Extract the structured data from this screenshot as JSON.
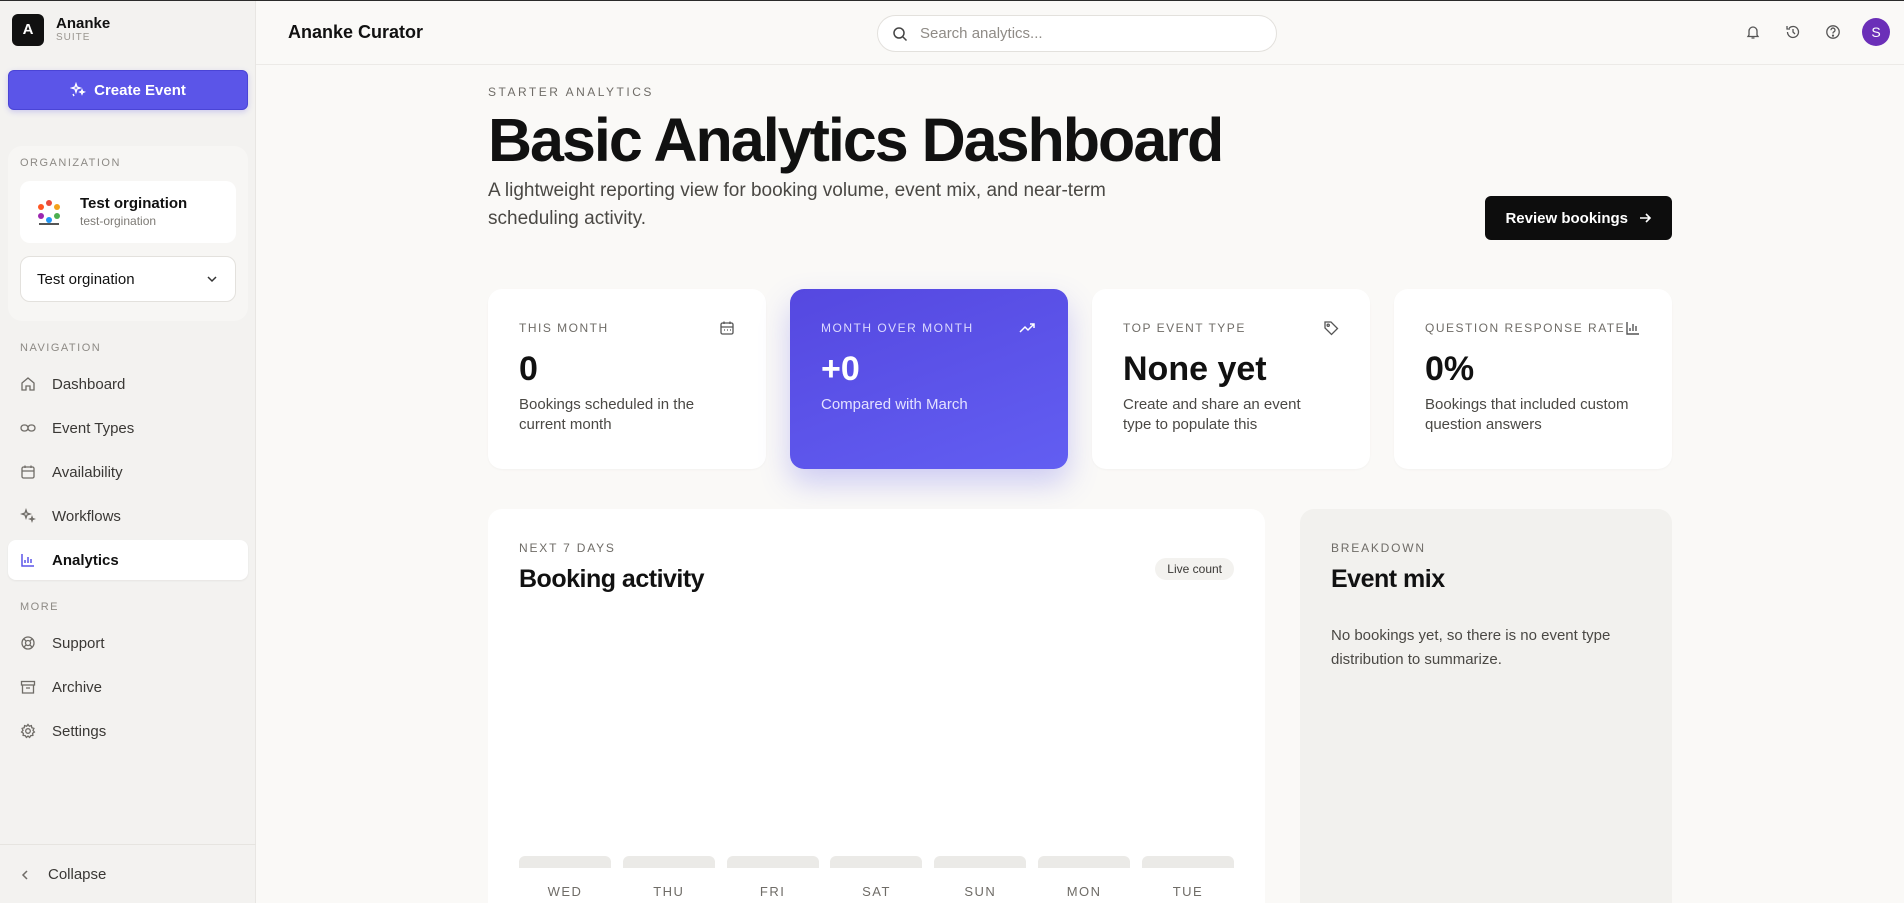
{
  "brand": {
    "initial": "A",
    "name": "Ananke",
    "sub": "SUITE"
  },
  "sidebar": {
    "create_label": "Create Event",
    "org_section_label": "ORGANIZATION",
    "org_name": "Test orgination",
    "org_slug": "test-orgination",
    "org_select_value": "Test orgination",
    "nav_label": "NAVIGATION",
    "nav_items": [
      {
        "label": "Dashboard",
        "icon": "home-icon"
      },
      {
        "label": "Event Types",
        "icon": "link-icon"
      },
      {
        "label": "Availability",
        "icon": "calendar-icon"
      },
      {
        "label": "Workflows",
        "icon": "sparkle-icon"
      },
      {
        "label": "Analytics",
        "icon": "bar-chart-icon",
        "active": true
      }
    ],
    "more_label": "MORE",
    "more_items": [
      {
        "label": "Support",
        "icon": "lifebuoy-icon"
      },
      {
        "label": "Archive",
        "icon": "archive-icon"
      },
      {
        "label": "Settings",
        "icon": "gear-icon"
      }
    ],
    "collapse_label": "Collapse"
  },
  "topbar": {
    "title": "Ananke Curator",
    "search_placeholder": "Search analytics...",
    "avatar_initial": "S"
  },
  "page": {
    "eyebrow": "STARTER ANALYTICS",
    "title": "Basic Analytics Dashboard",
    "description": "A lightweight reporting view for booking volume, event mix, and near-term scheduling activity.",
    "review_label": "Review bookings"
  },
  "stats": [
    {
      "label": "THIS MONTH",
      "value": "0",
      "desc": "Bookings scheduled in the current month",
      "icon": "calendar-icon"
    },
    {
      "label": "MONTH OVER MONTH",
      "value": "+0",
      "desc": "Compared with March",
      "icon": "trending-up-icon"
    },
    {
      "label": "TOP EVENT TYPE",
      "value": "None yet",
      "desc": "Create and share an event type to populate this",
      "icon": "tag-icon"
    },
    {
      "label": "QUESTION RESPONSE RATE",
      "value": "0%",
      "desc": "Bookings that included custom question answers",
      "icon": "bar-chart-icon"
    }
  ],
  "activity": {
    "eyebrow": "NEXT 7 DAYS",
    "title": "Booking activity",
    "badge": "Live count",
    "days": [
      "WED",
      "THU",
      "FRI",
      "SAT",
      "SUN",
      "MON",
      "TUE"
    ]
  },
  "mix": {
    "eyebrow": "BREAKDOWN",
    "title": "Event mix",
    "empty": "No bookings yet, so there is no event type distribution to summarize."
  },
  "colors": {
    "accent": "#5b55e8",
    "avatar": "#6b2fb8",
    "dark": "#0d0d0d"
  }
}
